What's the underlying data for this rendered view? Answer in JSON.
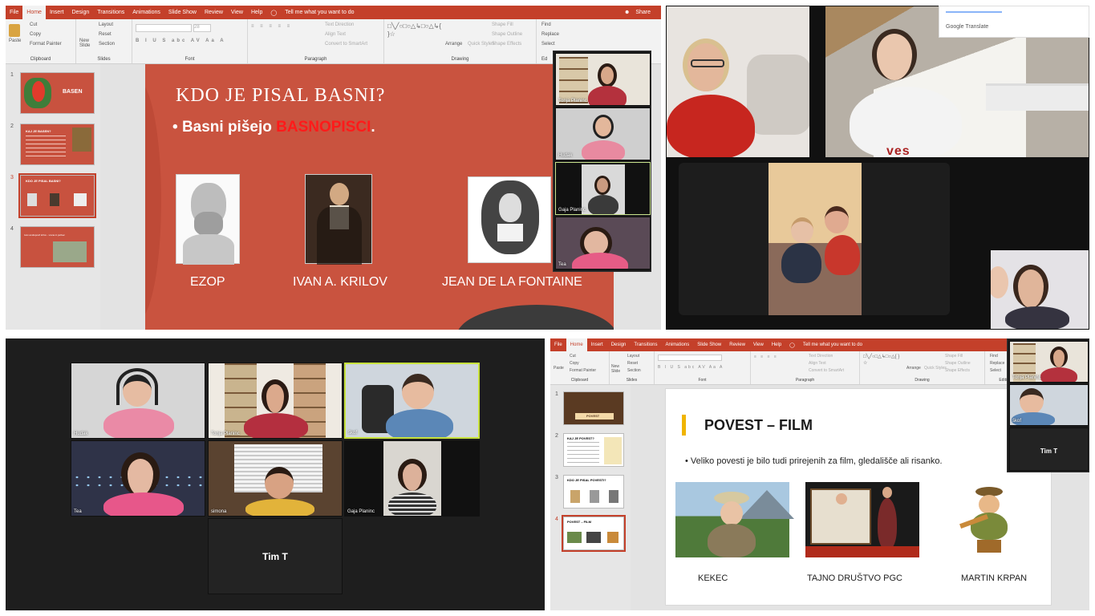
{
  "ppt1": {
    "tabs": [
      "File",
      "Home",
      "Insert",
      "Design",
      "Transitions",
      "Animations",
      "Slide Show",
      "Review",
      "View",
      "Help"
    ],
    "tell_me": "Tell me what you want to do",
    "share": "Share",
    "ribbon": {
      "paste": "Paste",
      "cut": "Cut",
      "copy": "Copy",
      "format_painter": "Format Painter",
      "clipboard": "Clipboard",
      "new_slide": "New Slide",
      "layout": "Layout",
      "reset": "Reset",
      "section": "Section",
      "slides": "Slides",
      "font": "Font",
      "font_size": "28",
      "paragraph": "Paragraph",
      "text_direction": "Text Direction",
      "align_text": "Align Text",
      "convert_smartart": "Convert to SmartArt",
      "arrange": "Arrange",
      "quick_styles": "Quick Styles",
      "shape_fill": "Shape Fill",
      "shape_outline": "Shape Outline",
      "shape_effects": "Shape Effects",
      "drawing": "Drawing",
      "find": "Find",
      "replace": "Replace",
      "select": "Select",
      "editing": "Ed"
    },
    "thumbnails": [
      {
        "num": "1",
        "title": "BASEN"
      },
      {
        "num": "2",
        "title": "KAJ JE BASEN?"
      },
      {
        "num": "3",
        "title": "KDO JE PISAL BASNI?"
      },
      {
        "num": "4",
        "title": "Ivan andrejevič krilov - vrana in jazbec"
      }
    ],
    "slide": {
      "title": "KDO JE PISAL BASNI?",
      "bullet_prefix": "Basni pišejo ",
      "bullet_highlight": "BASNOPISCI",
      "bullet_suffix": ".",
      "authors": [
        "EZOP",
        "IVAN A. KRILOV",
        "JEAN DE LA FONTAINE"
      ]
    },
    "participants": [
      "Tonja Planinc",
      "Hudak",
      "Gaja Planinc",
      "Tea"
    ]
  },
  "video1": {
    "translate_label": "Google Translate",
    "shirt_text": "ves"
  },
  "gallery": {
    "participants": [
      "Hudak",
      "Tonja Planinc",
      "škof",
      "Tea",
      "simona",
      "Gaja Planinc"
    ],
    "tim_label": "Tim T"
  },
  "ppt2": {
    "tabs": [
      "File",
      "Home",
      "Insert",
      "Design",
      "Transitions",
      "Animations",
      "Slide Show",
      "Review",
      "View",
      "Help"
    ],
    "tell_me": "Tell me what you want to do",
    "ribbon": {
      "paste": "Paste",
      "cut": "Cut",
      "copy": "Copy",
      "format_painter": "Format Painter",
      "clipboard": "Clipboard",
      "new_slide": "New Slide",
      "layout": "Layout",
      "reset": "Reset",
      "section": "Section",
      "slides": "Slides",
      "font": "Font",
      "paragraph": "Paragraph",
      "text_direction": "Text Direction",
      "align_text": "Align Text",
      "convert_smartart": "Convert to SmartArt",
      "arrange": "Arrange",
      "quick_styles": "Quick Styles",
      "shape_fill": "Shape Fill",
      "shape_outline": "Shape Outline",
      "shape_effects": "Shape Effects",
      "drawing": "Drawing",
      "find": "Find",
      "replace": "Replace",
      "select": "Select",
      "editing": "Editing"
    },
    "thumbnails": [
      {
        "num": "1",
        "title": "POVEST"
      },
      {
        "num": "2",
        "title": "KAJ JE POVEST?"
      },
      {
        "num": "3",
        "title": "KDO JE PISAL POVESTI?"
      },
      {
        "num": "4",
        "title": "POVEST – FILM"
      }
    ],
    "slide": {
      "title": "POVEST – FILM",
      "bullet": "Veliko povesti je bilo tudi prirejenih za film, gledališče ali risanko.",
      "items": [
        "KEKEC",
        "TAJNO DRUŠTVO PGC",
        "MARTIN KRPAN"
      ]
    },
    "participants": [
      "Tonja Planinc",
      "škof"
    ],
    "tim_label": "Tim T"
  }
}
